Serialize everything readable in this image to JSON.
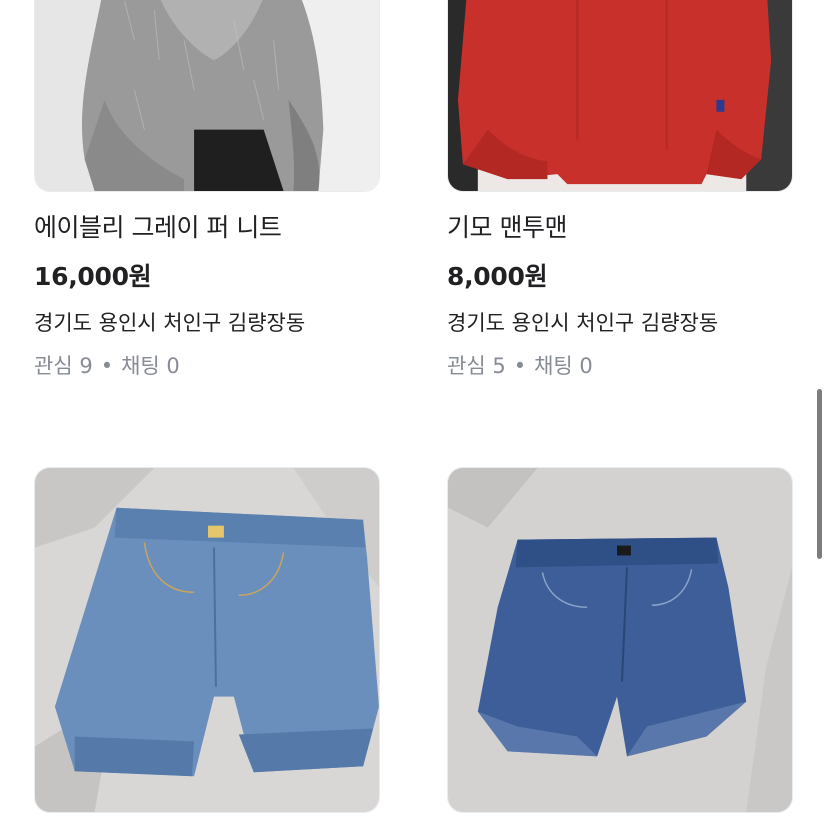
{
  "products": [
    {
      "title": "에이블리 그레이 퍼 니트",
      "price": "16,000원",
      "region": "경기도 용인시 처인구 김량장동",
      "interest_label": "관심 9",
      "chat_label": "채팅 0",
      "image": "gray-fur-knit-photo"
    },
    {
      "title": "기모 맨투맨",
      "price": "8,000원",
      "region": "경기도 용인시 처인구 김량장동",
      "interest_label": "관심 5",
      "chat_label": "채팅 0",
      "image": "red-sweatshirt-photo"
    },
    {
      "image": "denim-shorts-light-photo"
    },
    {
      "image": "denim-shorts-dark-photo"
    }
  ],
  "separator": "•",
  "colors": {
    "text": "#212124",
    "muted": "#868b94",
    "border": "#e9ecef"
  }
}
